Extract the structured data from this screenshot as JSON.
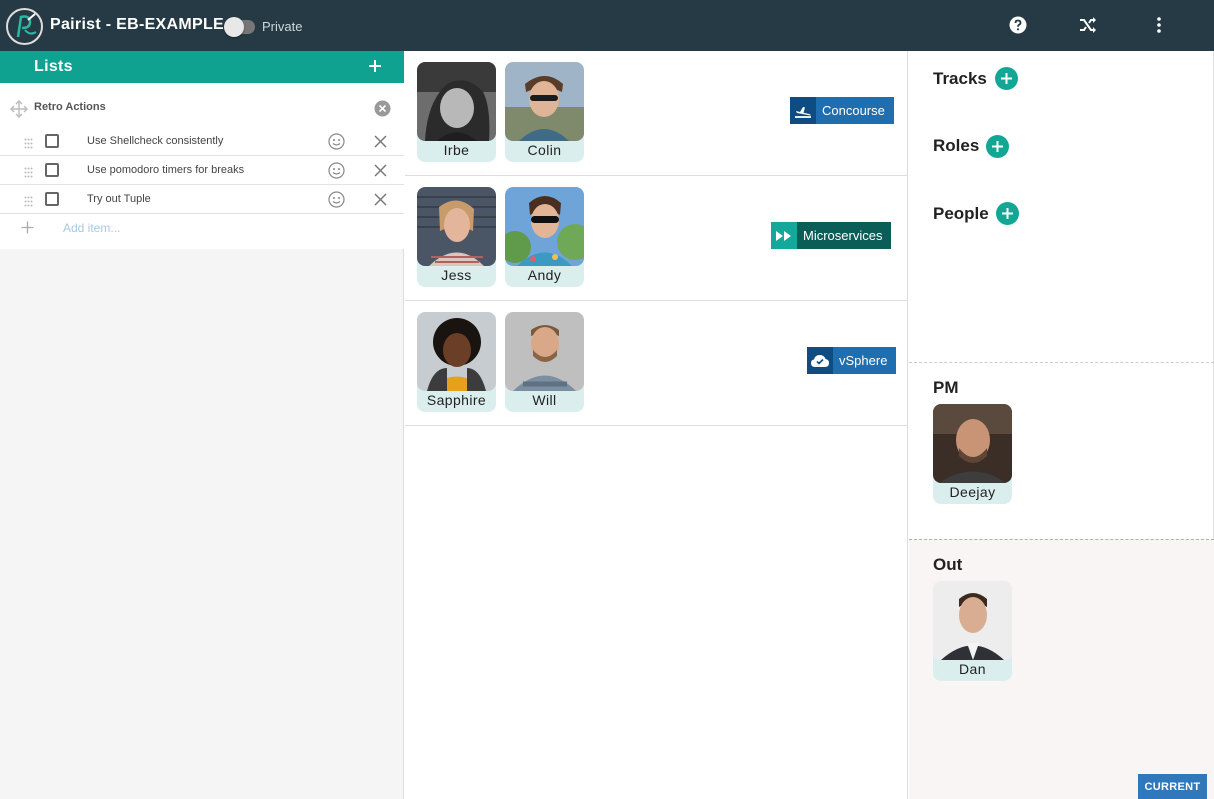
{
  "header": {
    "title": "Pairist - EB-EXAMPLE",
    "private_label": "Private",
    "private_on": false,
    "icons": [
      "help-icon",
      "shuffle-icon",
      "more-vert-icon"
    ]
  },
  "lists_panel": {
    "title": "Lists",
    "list": {
      "name": "Retro Actions",
      "items": [
        {
          "text": "Use Shellcheck consistently",
          "checked": false
        },
        {
          "text": "Use pomodoro timers for breaks",
          "checked": false
        },
        {
          "text": "Try out Tuple",
          "checked": false
        }
      ],
      "add_placeholder": "Add item..."
    }
  },
  "lanes": [
    {
      "people": [
        "Irbe",
        "Colin"
      ],
      "track": {
        "label": "Concourse",
        "icon": "flight-takeoff-icon",
        "color": "#1f6fb0"
      }
    },
    {
      "people": [
        "Jess",
        "Andy"
      ],
      "track": {
        "label": "Microservices",
        "icon": "fast-forward-icon",
        "color": "#0b5e57"
      }
    },
    {
      "people": [
        "Sapphire",
        "Will"
      ],
      "track": {
        "label": "vSphere",
        "icon": "cloud-done-icon",
        "color": "#1f6fb0"
      }
    }
  ],
  "sidebar": {
    "tracks_label": "Tracks",
    "roles_label": "Roles",
    "people_label": "People",
    "pm_label": "PM",
    "pm_person": "Deejay",
    "out_label": "Out",
    "out_person": "Dan"
  },
  "footer": {
    "current_label": "CURRENT"
  },
  "colors": {
    "topbar": "#263a45",
    "accent": "#0fa291",
    "add_button": "#12a795",
    "current_button": "#2e78bb"
  }
}
